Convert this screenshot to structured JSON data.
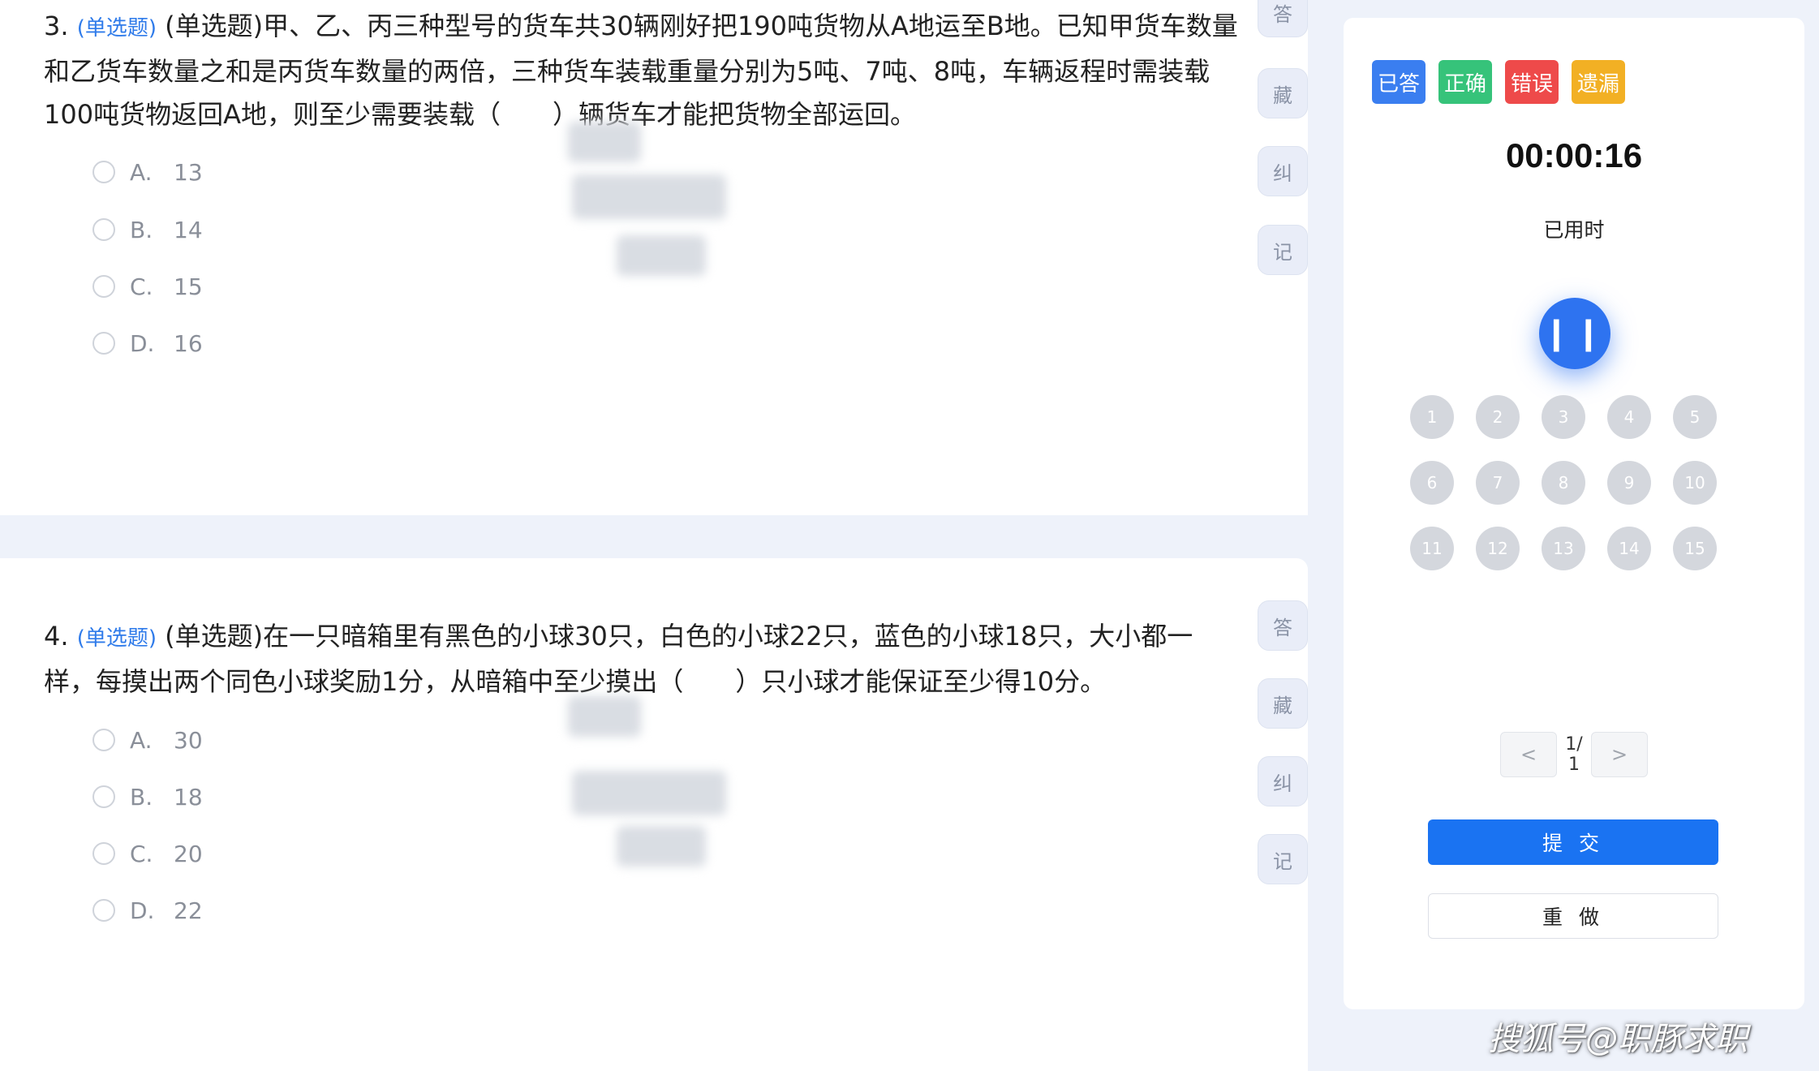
{
  "questions": [
    {
      "number": "3.",
      "type_tag": "(单选题)",
      "text": "(单选题)甲、乙、丙三种型号的货车共30辆刚好把190吨货物从A地运至B地。已知甲货车数量和乙货车数量之和是丙货车数量的两倍，三种货车装载重量分别为5吨、7吨、8吨，车辆返程时需装载100吨货物返回A地，则至少需要装载（　　）辆货车才能把货物全部运回。",
      "options": [
        {
          "letter": "A.",
          "value": "13"
        },
        {
          "letter": "B.",
          "value": "14"
        },
        {
          "letter": "C.",
          "value": "15"
        },
        {
          "letter": "D.",
          "value": "16"
        }
      ]
    },
    {
      "number": "4.",
      "type_tag": "(单选题)",
      "text": "(单选题)在一只暗箱里有黑色的小球30只，白色的小球22只，蓝色的小球18只，大小都一样，每摸出两个同色小球奖励1分，从暗箱中至少摸出（　　）只小球才能保证至少得10分。",
      "options": [
        {
          "letter": "A.",
          "value": "30"
        },
        {
          "letter": "B.",
          "value": "18"
        },
        {
          "letter": "C.",
          "value": "20"
        },
        {
          "letter": "D.",
          "value": "22"
        }
      ]
    }
  ],
  "side_actions": {
    "answer": "答",
    "favorite": "藏",
    "correct": "纠",
    "note": "记"
  },
  "panel": {
    "tags": [
      {
        "label": "已答",
        "color": "#3a7ef0"
      },
      {
        "label": "正确",
        "color": "#36c37a"
      },
      {
        "label": "错误",
        "color": "#ee4a4a"
      },
      {
        "label": "遗漏",
        "color": "#f2b024"
      }
    ],
    "timer": "00:00:16",
    "timer_label": "已用时",
    "pause_icon": "pause-icon",
    "numbers": [
      "1",
      "2",
      "3",
      "4",
      "5",
      "6",
      "7",
      "8",
      "9",
      "10",
      "11",
      "12",
      "13",
      "14",
      "15"
    ],
    "pager": {
      "prev": "<",
      "info": "1/ 1",
      "next": ">"
    },
    "submit": "提 交",
    "redo": "重 做"
  },
  "watermark": "搜狐号@职豚求职"
}
